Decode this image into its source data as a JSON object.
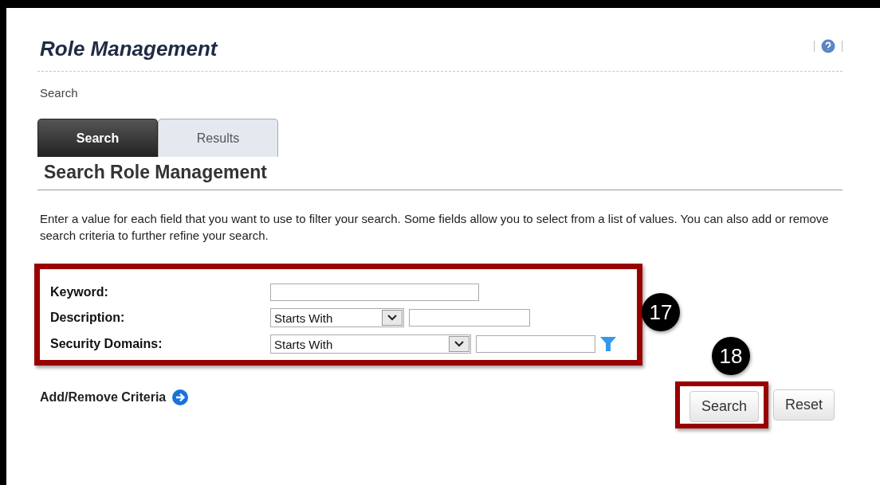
{
  "page": {
    "title": "Role Management",
    "breadcrumb": "Search"
  },
  "tabs": [
    {
      "label": "Search",
      "selected": true
    },
    {
      "label": "Results",
      "selected": false
    }
  ],
  "section": {
    "heading": "Search Role Management",
    "instructions": "Enter a value for each field that you want to use to filter your search. Some fields allow you to select from a list of values. You can also add or remove search criteria to further refine your search."
  },
  "criteria": {
    "callout": "17",
    "fields": [
      {
        "label": "Keyword:",
        "kind": "text"
      },
      {
        "label": "Description:",
        "kind": "select_text",
        "operator": "Starts With"
      },
      {
        "label": "Security Domains:",
        "kind": "select_text_filter",
        "operator": "Starts With"
      }
    ]
  },
  "add_remove": {
    "label": "Add/Remove Criteria"
  },
  "buttons": [
    {
      "label": "Search",
      "callout": "18"
    },
    {
      "label": "Reset"
    }
  ]
}
